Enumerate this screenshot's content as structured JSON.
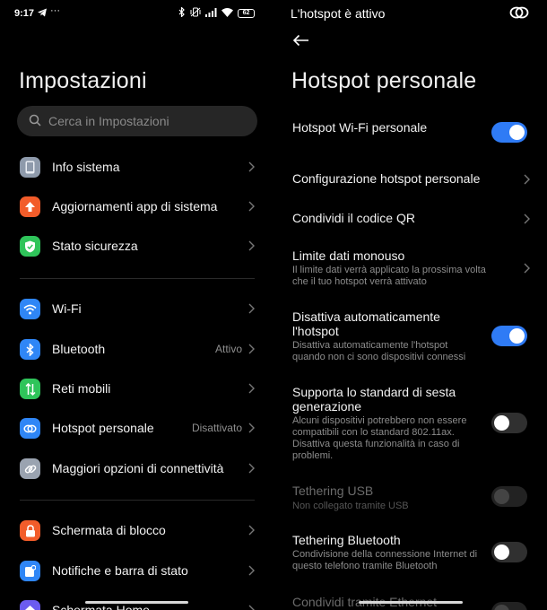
{
  "left_status": {
    "time": "9:17",
    "battery": "62"
  },
  "left": {
    "title": "Impostazioni",
    "search_placeholder": "Cerca in Impostazioni",
    "items": [
      {
        "label": "Info sistema",
        "icon": "phone-icon",
        "color": "#8e9aab"
      },
      {
        "label": "Aggiornamenti app di sistema",
        "icon": "arrow-up-icon",
        "color": "#f25c2a"
      },
      {
        "label": "Stato sicurezza",
        "icon": "shield-check-icon",
        "color": "#2fc45a"
      },
      {
        "label": "Wi-Fi",
        "icon": "wifi-icon",
        "color": "#2f86f6"
      },
      {
        "label": "Bluetooth",
        "value": "Attivo",
        "icon": "bluetooth-icon",
        "color": "#2f86f6"
      },
      {
        "label": "Reti mobili",
        "icon": "mobile-data-icon",
        "color": "#2fc45a"
      },
      {
        "label": "Hotspot personale",
        "value": "Disattivato",
        "icon": "hotspot-icon",
        "color": "#2f86f6"
      },
      {
        "label": "Maggiori opzioni di connettività",
        "icon": "link-icon",
        "color": "#9aa3b0"
      },
      {
        "label": "Schermata di blocco",
        "icon": "lock-icon",
        "color": "#f25c2a"
      },
      {
        "label": "Notifiche e barra di stato",
        "icon": "notification-icon",
        "color": "#2f86f6"
      },
      {
        "label": "Schermata Home",
        "icon": "home-icon",
        "color": "#6b5cf0"
      }
    ]
  },
  "right_status": {
    "text": "L'hotspot è attivo"
  },
  "right": {
    "title": "Hotspot personale",
    "rows": [
      {
        "title": "Hotspot Wi-Fi personale",
        "toggle": "on"
      },
      {
        "title": "Configurazione hotspot personale",
        "chevron": true
      },
      {
        "title": "Condividi il codice QR",
        "chevron": true
      },
      {
        "title": "Limite dati monouso",
        "subtitle": "Il limite dati verrà applicato la prossima volta che il tuo hotspot verrà attivato",
        "chevron": true
      },
      {
        "title": "Disattiva automaticamente l'hotspot",
        "subtitle": "Disattiva automaticamente l'hotspot quando non ci sono dispositivi connessi",
        "toggle": "on"
      },
      {
        "title": "Supporta lo standard di sesta generazione",
        "subtitle": "Alcuni dispositivi potrebbero non essere compatibili con lo standard 802.11ax. Disattiva questa funzionalità in caso di problemi.",
        "toggle": "off"
      },
      {
        "title": "Tethering USB",
        "subtitle": "Non collegato tramite USB",
        "toggle": "disabled"
      },
      {
        "title": "Tethering Bluetooth",
        "subtitle": "Condivisione della connessione Internet di questo telefono tramite Bluetooth",
        "toggle": "off"
      },
      {
        "title": "Condividi tramite Ethernet",
        "toggle": "disabled"
      }
    ]
  },
  "colors": {
    "accent": "#2f7bf5",
    "background": "#000000",
    "search_bg": "#262626"
  }
}
